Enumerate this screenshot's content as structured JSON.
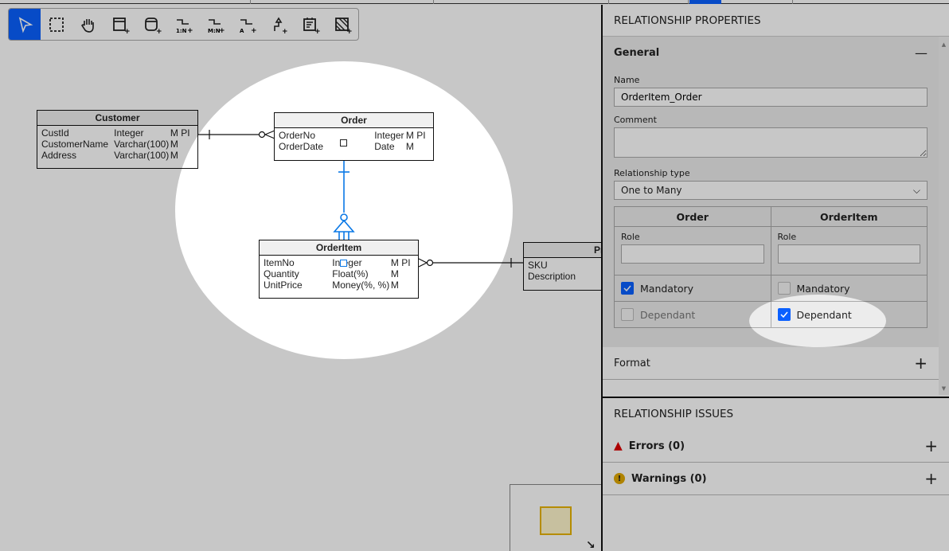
{
  "toolbar": {
    "tools": [
      {
        "icon": "pointer-icon",
        "active": true
      },
      {
        "icon": "marquee-select-icon"
      },
      {
        "icon": "hand-pan-icon"
      },
      {
        "icon": "add-entity-icon"
      },
      {
        "icon": "add-view-icon"
      },
      {
        "icon": "add-one-to-many-icon",
        "label": "1:N"
      },
      {
        "icon": "add-many-to-many-icon",
        "label": "M:N"
      },
      {
        "icon": "add-arc-icon",
        "label": "A"
      },
      {
        "icon": "add-inheritance-icon"
      },
      {
        "icon": "add-note-icon"
      },
      {
        "icon": "add-area-icon"
      }
    ]
  },
  "diagram": {
    "customer": {
      "title": "Customer",
      "rows": [
        [
          "CustId",
          "Integer",
          "M PI"
        ],
        [
          "CustomerName",
          "Varchar(100)",
          "M"
        ],
        [
          "Address",
          "Varchar(100)",
          "M"
        ]
      ]
    },
    "order": {
      "title": "Order",
      "rows": [
        [
          "OrderNo",
          "Integer",
          "M PI"
        ],
        [
          "OrderDate",
          "Date",
          "M"
        ]
      ]
    },
    "orderitem": {
      "title": "OrderItem",
      "rows": [
        [
          "ItemNo",
          "Integer",
          "M PI"
        ],
        [
          "Quantity",
          "Float(%)",
          "M"
        ],
        [
          "UnitPrice",
          "Money(%, %)",
          "M"
        ]
      ]
    },
    "product": {
      "title": "Pro",
      "rows": [
        [
          "SKU"
        ],
        [
          "Description"
        ]
      ]
    },
    "selected_color": "#0a78e6"
  },
  "panel": {
    "title": "RELATIONSHIP PROPERTIES",
    "general": {
      "label": "General",
      "name_label": "Name",
      "name_value": "OrderItem_Order",
      "comment_label": "Comment",
      "comment_value": "",
      "type_label": "Relationship type",
      "type_value": "One to Many",
      "table": {
        "col1": "Order",
        "col2": "OrderItem",
        "role_label": "Role",
        "mandatory_label": "Mandatory",
        "dependant_label": "Dependant",
        "order_mandatory": true,
        "order_dependant": false,
        "orderitem_mandatory": false,
        "orderitem_dependant": true
      }
    },
    "format_label": "Format",
    "issues_title": "RELATIONSHIP ISSUES",
    "errors_label": "Errors (0)",
    "warnings_label": "Warnings (0)"
  },
  "accent": "#0a60ff"
}
